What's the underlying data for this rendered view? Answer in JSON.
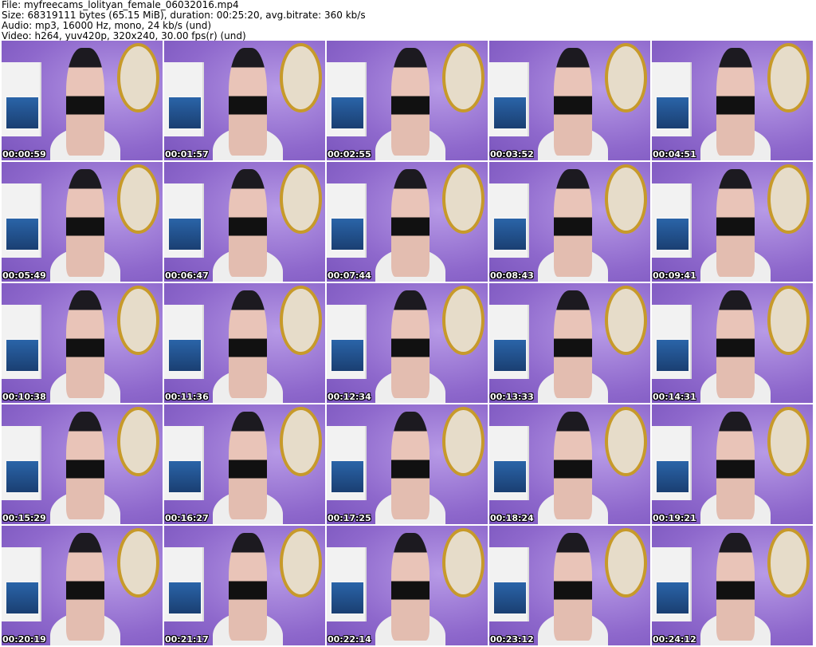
{
  "header": {
    "file_line": "File: myfreecams_lolityan_female_06032016.mp4",
    "size_line": "Size: 68319111 bytes (65.15 MiB), duration: 00:25:20, avg.bitrate: 360 kb/s",
    "audio_line": "Audio: mp3, 16000 Hz, mono, 24 kb/s (und)",
    "video_line": "Video: h264, yuv420p, 320x240, 30.00 fps(r) (und)"
  },
  "thumbnails": [
    {
      "timestamp": "00:00:59"
    },
    {
      "timestamp": "00:01:57"
    },
    {
      "timestamp": "00:02:55"
    },
    {
      "timestamp": "00:03:52"
    },
    {
      "timestamp": "00:04:51"
    },
    {
      "timestamp": "00:05:49"
    },
    {
      "timestamp": "00:06:47"
    },
    {
      "timestamp": "00:07:44"
    },
    {
      "timestamp": "00:08:43"
    },
    {
      "timestamp": "00:09:41"
    },
    {
      "timestamp": "00:10:38"
    },
    {
      "timestamp": "00:11:36"
    },
    {
      "timestamp": "00:12:34"
    },
    {
      "timestamp": "00:13:33"
    },
    {
      "timestamp": "00:14:31"
    },
    {
      "timestamp": "00:15:29"
    },
    {
      "timestamp": "00:16:27"
    },
    {
      "timestamp": "00:17:25"
    },
    {
      "timestamp": "00:18:24"
    },
    {
      "timestamp": "00:19:21"
    },
    {
      "timestamp": "00:20:19"
    },
    {
      "timestamp": "00:21:17"
    },
    {
      "timestamp": "00:22:14"
    },
    {
      "timestamp": "00:23:12"
    },
    {
      "timestamp": "00:24:12"
    }
  ]
}
